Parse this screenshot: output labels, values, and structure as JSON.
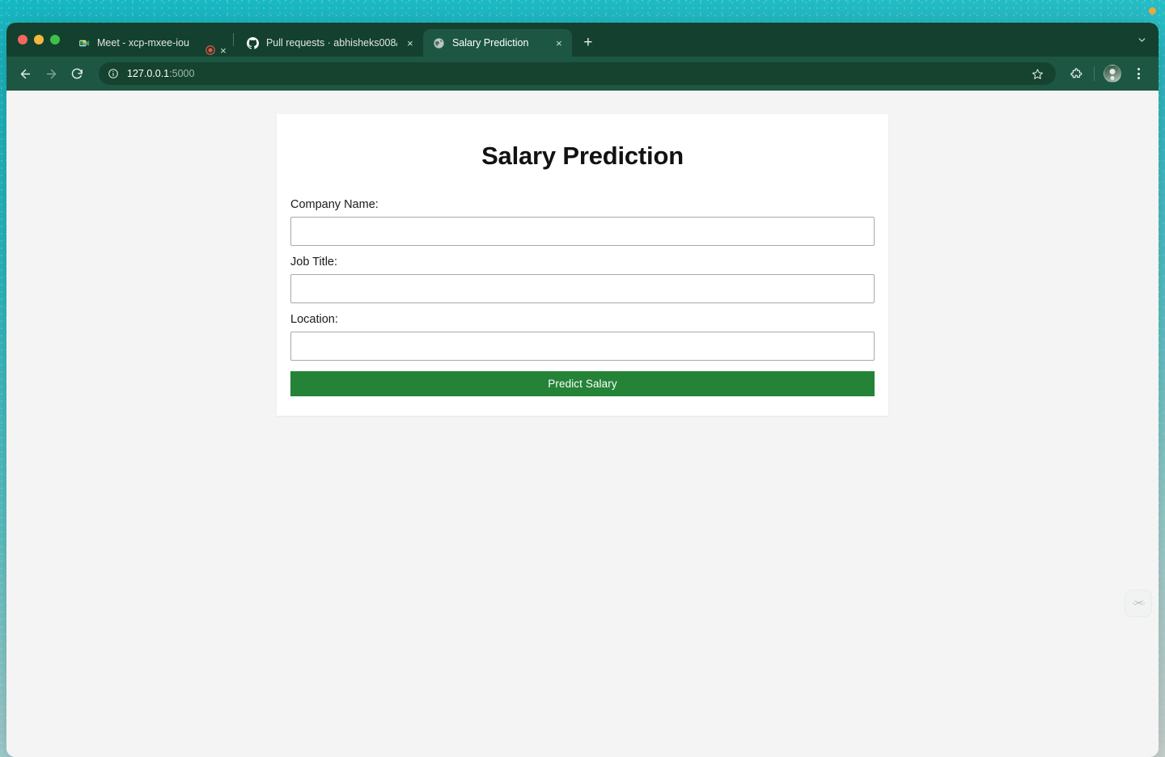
{
  "desktop": {
    "accent_dot_color": "#f0a93a",
    "wallpaper_colors": [
      "#16b8c4",
      "#5fc9cc",
      "#cfd9d6"
    ]
  },
  "browser": {
    "window_controls": [
      {
        "name": "close",
        "color": "#f2675f"
      },
      {
        "name": "minimize",
        "color": "#f6b73c"
      },
      {
        "name": "maximize",
        "color": "#3fc04a"
      }
    ],
    "tabs": [
      {
        "title": "Meet - xcp-mxee-iou",
        "favicon": "google-meet-icon",
        "active": false,
        "close_label": "×"
      },
      {
        "title": "Pull requests · abhisheks008/",
        "favicon": "github-icon",
        "active": false,
        "close_label": "×"
      },
      {
        "title": "Salary Prediction",
        "favicon": "globe-icon",
        "active": true,
        "close_label": "×"
      }
    ],
    "recording_indicator": {
      "name": "recording-icon",
      "color": "#e8554c"
    },
    "new_tab_label": "+",
    "tabstrip_chevron": "∨",
    "toolbar": {
      "back_label": "←",
      "forward_label": "→",
      "reload_label": "↻",
      "site_info_icon": "info-circle-icon",
      "url_host": "127.0.0.1",
      "url_port": ":5000",
      "bookmark_icon": "star-icon",
      "extensions_icon": "puzzle-icon",
      "profile_icon": "avatar-icon",
      "menu_icon": "kebab-menu-icon"
    }
  },
  "page": {
    "title": "Salary Prediction",
    "accent_color": "#248337",
    "background_color": "#f4f4f4",
    "fields": [
      {
        "label": "Company Name:",
        "value": "",
        "placeholder": "",
        "name": "company-name"
      },
      {
        "label": "Job Title:",
        "value": "",
        "placeholder": "",
        "name": "job-title"
      },
      {
        "label": "Location:",
        "value": "",
        "placeholder": "",
        "name": "location"
      }
    ],
    "submit_label": "Predict Salary",
    "floating_widget_label": "·><·"
  }
}
